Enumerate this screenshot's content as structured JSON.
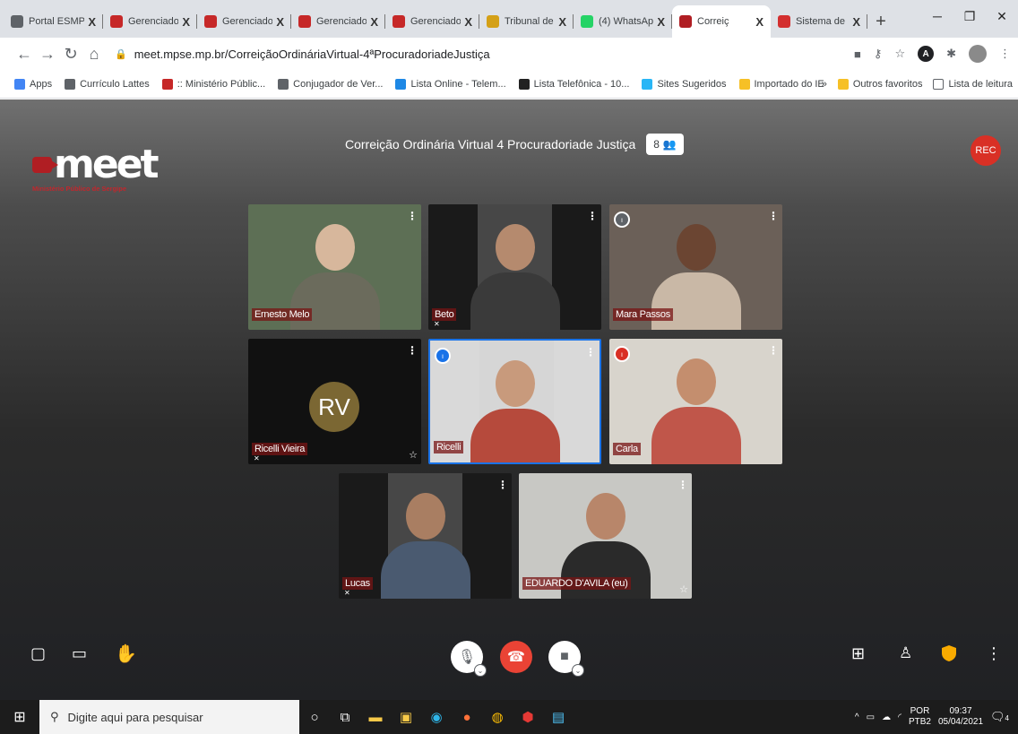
{
  "browser": {
    "tabs": [
      {
        "title": "Portal ESMP",
        "icon_color": "#5f6368",
        "icon": "globe-icon",
        "active": false
      },
      {
        "title": "Gerenciado",
        "icon_color": "#c62828",
        "icon": "app-icon",
        "active": false
      },
      {
        "title": "Gerenciado",
        "icon_color": "#c62828",
        "icon": "app-icon",
        "active": false
      },
      {
        "title": "Gerenciado",
        "icon_color": "#c62828",
        "icon": "app-icon",
        "active": false
      },
      {
        "title": "Gerenciado",
        "icon_color": "#c62828",
        "icon": "app-icon",
        "active": false
      },
      {
        "title": "Tribunal de",
        "icon_color": "#d4a017",
        "icon": "court-icon",
        "active": false
      },
      {
        "title": "(4) WhatsAp",
        "icon_color": "#25d366",
        "icon": "whatsapp-icon",
        "active": false
      },
      {
        "title": "Correiç",
        "icon_color": "#b01e23",
        "icon": "meet-icon",
        "active": true
      },
      {
        "title": "Sistema de",
        "icon_color": "#d32f2f",
        "icon": "pdf-icon",
        "active": false
      }
    ],
    "new_tab": "+",
    "close_glyph": "X",
    "url": "meet.mpse.mp.br/CorreiçãoOrdináriaVirtual-4ªProcuradoriadeJustiça",
    "bookmarks": [
      {
        "label": "Apps",
        "color": "#4285f4"
      },
      {
        "label": "Currículo Lattes",
        "color": "#5f6368"
      },
      {
        "label": ":: Ministério Públic...",
        "color": "#c62828"
      },
      {
        "label": "Conjugador de Ver...",
        "color": "#5f6368"
      },
      {
        "label": "Lista Online - Telem...",
        "color": "#1e88e5"
      },
      {
        "label": "Lista Telefônica - 10...",
        "color": "#212121"
      },
      {
        "label": "Sites Sugeridos",
        "color": "#29b6f6"
      },
      {
        "label": "Importado do IE",
        "color": "#f6c026"
      }
    ],
    "bookmarks_overflow": "»",
    "other_bookmarks": "Outros favoritos",
    "reading_list": "Lista de leitura"
  },
  "meet": {
    "logo_text": "meet",
    "logo_sub": "Ministério Público de Sergipe",
    "title": "Correição Ordinária Virtual 4 Procuradoriade Justiça",
    "participant_count": "8",
    "rec_label": "REC",
    "tiles": [
      {
        "name": "Ernesto Melo",
        "bg": "#5d6f55",
        "skin": "#d7b79c",
        "shirt": "#6b6b5c",
        "muted": false,
        "indicator": ""
      },
      {
        "name": "Beto",
        "bg": "#1a1a1a",
        "skin": "#b58a6e",
        "shirt": "#3a3a3a",
        "muted": true,
        "indicator": ""
      },
      {
        "name": "Mara Passos",
        "bg": "#6b6058",
        "skin": "#6b4532",
        "shirt": "#c9b8a6",
        "muted": false,
        "indicator": "gray"
      },
      {
        "name": "Ricelli Vieira",
        "bg": "#111111",
        "initials": "RV",
        "muted": true,
        "indicator": ""
      },
      {
        "name": "Ricelli",
        "bg": "#d9d9d9",
        "skin": "#c89a7c",
        "shirt": "#b64a3c",
        "muted": false,
        "indicator": "blue"
      },
      {
        "name": "Carla",
        "bg": "#d8d4cc",
        "skin": "#c48e6e",
        "shirt": "#c0564a",
        "muted": false,
        "indicator": "red"
      },
      {
        "name": "Lucas",
        "bg": "#1a1a1a",
        "skin": "#a97e62",
        "shirt": "#4a5a70",
        "muted": true,
        "indicator": ""
      },
      {
        "name": "EDUARDO D'AVILA (eu)",
        "bg": "#c8c8c4",
        "skin": "#b8866a",
        "shirt": "#2a2a2a",
        "muted": false,
        "indicator": ""
      }
    ],
    "shield_color": "#f9ab00"
  },
  "taskbar": {
    "search_placeholder": "Digite aqui para pesquisar",
    "lang1": "POR",
    "lang2": "PTB2",
    "time": "09:37",
    "date": "05/04/2021",
    "notif_count": "4"
  }
}
